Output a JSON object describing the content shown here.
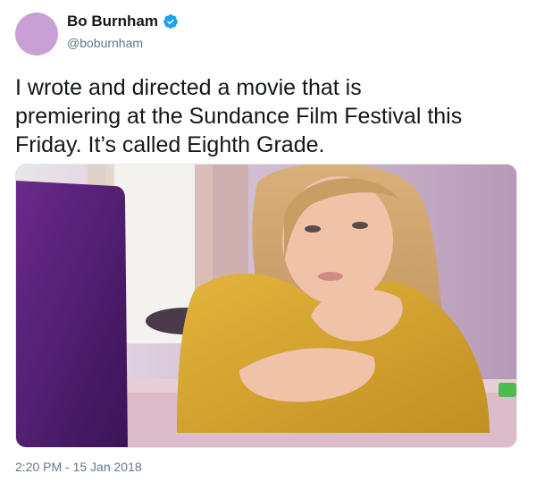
{
  "tweet": {
    "display_name": "Bo Burnham",
    "handle": "@boburnham",
    "text_lines": [
      "I wrote and directed a movie that is",
      "premiering at the Sundance Film Festival this",
      "Friday. It’s called Eighth Grade."
    ],
    "timestamp": "2:20 PM - 15 Jan 2018",
    "verified": true
  },
  "colors": {
    "avatar": "#c9a0d6",
    "verified_badge": "#1da1f2",
    "secondary_text": "#657786",
    "primary_text": "#14171a"
  },
  "icons": {
    "verified": "verified-badge-icon"
  }
}
